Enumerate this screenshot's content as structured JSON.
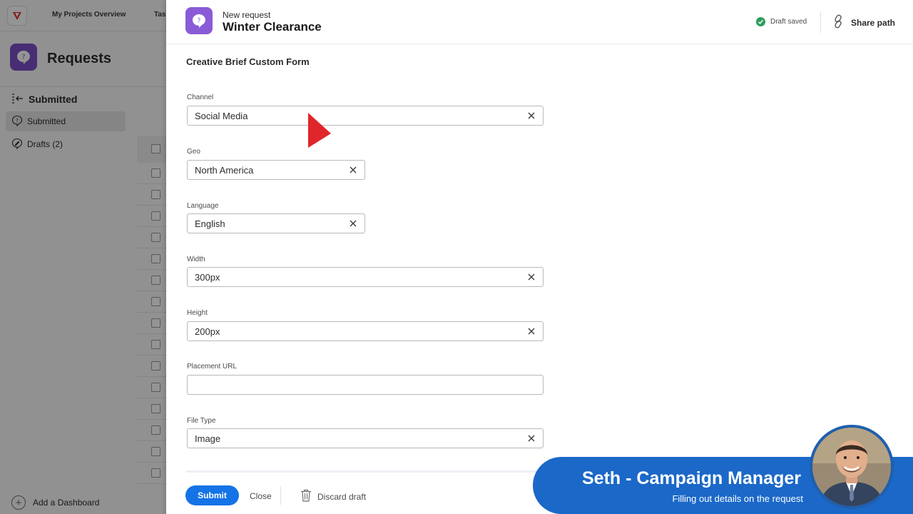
{
  "background_app": {
    "top_tabs": [
      "My Projects Overview",
      "Tasks"
    ],
    "page_title": "Requests",
    "subnav_header": "Submitted",
    "nav_items": [
      {
        "label": "Submitted",
        "active": true
      },
      {
        "label": "Drafts (2)",
        "active": false
      }
    ],
    "add_dashboard_label": "Add a Dashboard"
  },
  "panel": {
    "kicker": "New request",
    "title": "Winter Clearance",
    "draft_status": "Draft saved",
    "share_label": "Share path",
    "form_title": "Creative Brief Custom Form",
    "fields": [
      {
        "label": "Channel",
        "value": "Social Media"
      },
      {
        "label": "Geo",
        "value": "North America"
      },
      {
        "label": "Language",
        "value": "English"
      },
      {
        "label": "Width",
        "value": "300px"
      },
      {
        "label": "Height",
        "value": "200px"
      },
      {
        "label": "Placement URL",
        "value": ""
      },
      {
        "label": "File Type",
        "value": "Image"
      }
    ],
    "footer": {
      "submit_label": "Submit",
      "close_label": "Close",
      "discard_label": "Discard draft"
    }
  },
  "overlay": {
    "name": "Seth - Campaign Manager",
    "subtitle": "Filling out details on the request"
  },
  "colors": {
    "primary_blue": "#1473e6",
    "request_purple": "#8a5bd6",
    "saved_green": "#2d9d5f",
    "cursor_red": "#e0262b",
    "lower_third_blue": "#1b68c8"
  },
  "icons": [
    "app-logo-icon",
    "request-icon",
    "check-circle-icon",
    "link-icon",
    "clear-icon",
    "trash-icon",
    "cursor-arrow-icon",
    "add-circle-icon"
  ]
}
